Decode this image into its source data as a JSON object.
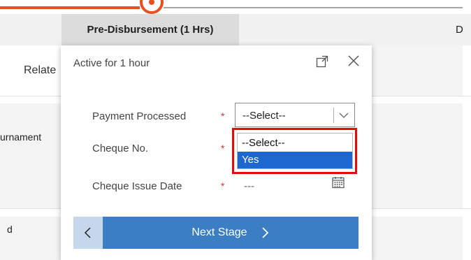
{
  "stages": {
    "active_label": "Pre-Disbursement  (1 Hrs)",
    "next_label_fragment": "D"
  },
  "background": {
    "related_tab": "Relate",
    "field_fragment_1": "urnament",
    "field_fragment_2": "d"
  },
  "flyout": {
    "header": "Active for 1 hour",
    "fields": [
      {
        "label": "Payment Processed",
        "required": "*",
        "value": "--Select--"
      },
      {
        "label": "Cheque No.",
        "required": "*"
      },
      {
        "label": "Cheque Issue Date",
        "required": "*",
        "value": "---"
      }
    ],
    "dropdown_options": [
      "--Select--",
      "Yes"
    ],
    "next_stage_label": "Next Stage"
  },
  "colors": {
    "accent_orange": "#e8501f",
    "primary_blue": "#3c7ec4",
    "selection_blue": "#1d67cf",
    "highlight_red": "#e10d0d"
  },
  "icons": [
    "expand-icon",
    "close-icon",
    "chevron-down-icon",
    "calendar-icon",
    "chevron-left-icon",
    "chevron-right-icon"
  ]
}
